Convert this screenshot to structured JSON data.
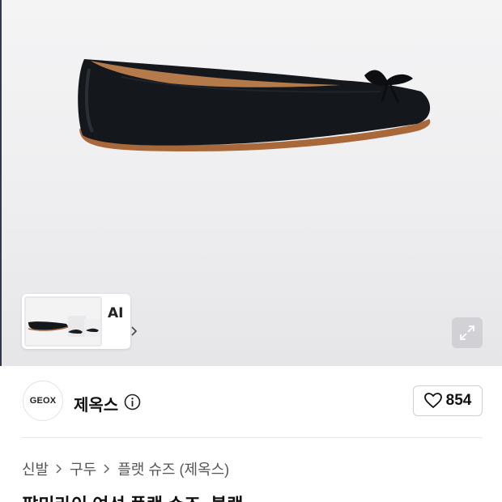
{
  "brand": {
    "logo_text": "GEOX",
    "name": "제옥스"
  },
  "gallery": {
    "thumb_label": "AI"
  },
  "like": {
    "count": "854"
  },
  "breadcrumb": [
    "신발",
    "구두",
    "플랫 슈즈 (제옥스)"
  ],
  "product": {
    "title": "팔미라이 여성 플랫 슈즈, 블랙"
  },
  "colors": {
    "accent_dark": "#111111",
    "background_hero": "#efeff1",
    "divider": "#e6e6e9"
  },
  "icons": [
    "chevron-right-icon",
    "expand-icon",
    "heart-icon",
    "info-icon"
  ]
}
